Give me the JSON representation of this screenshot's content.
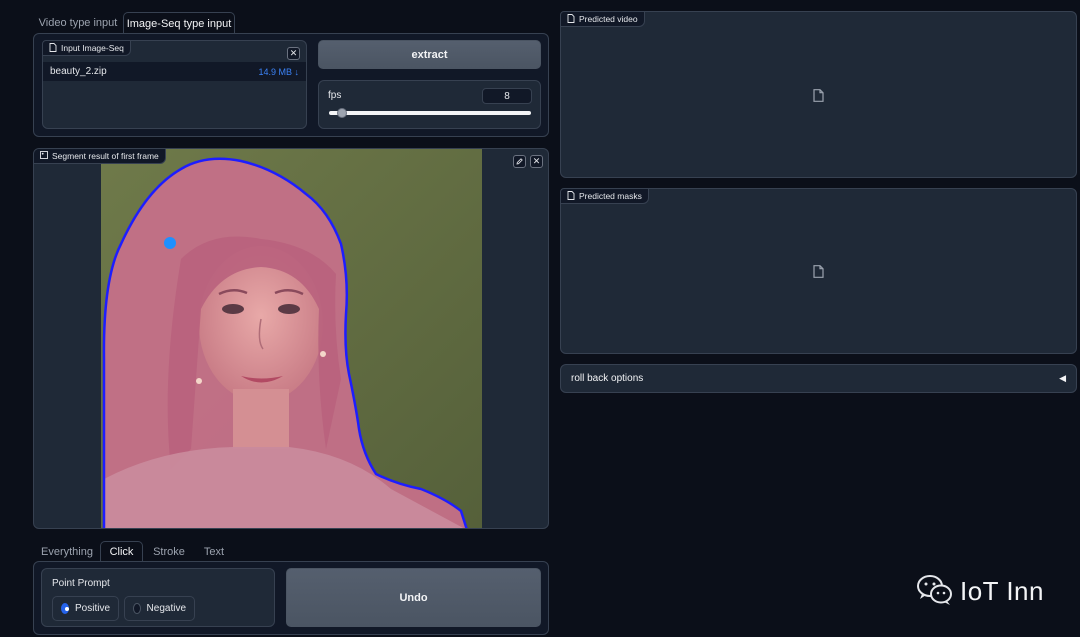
{
  "top_tabs": [
    {
      "label": "Video type input",
      "active": false
    },
    {
      "label": "Image-Seq type input",
      "active": true
    }
  ],
  "input_image_seq": {
    "label": "Input Image-Seq",
    "file_name": "beauty_2.zip",
    "file_size": "14.9 MB ↓"
  },
  "extract_button": "extract",
  "fps": {
    "label": "fps",
    "value": "8",
    "slider_fraction": 0.04
  },
  "segment_result": {
    "label": "Segment result of first frame"
  },
  "predicted_video": {
    "label": "Predicted video"
  },
  "predicted_masks": {
    "label": "Predicted masks"
  },
  "roll_back": {
    "label": "roll back options",
    "arrow": "◀"
  },
  "prompt_tabs": [
    {
      "label": "Everything",
      "active": false
    },
    {
      "label": "Click",
      "active": true
    },
    {
      "label": "Stroke",
      "active": false
    },
    {
      "label": "Text",
      "active": false
    }
  ],
  "point_prompt": {
    "label": "Point Prompt",
    "options": [
      {
        "label": "Positive",
        "selected": true
      },
      {
        "label": "Negative",
        "selected": false
      }
    ]
  },
  "undo_button": "Undo",
  "watermark": "IoT Inn",
  "colors": {
    "background": "#0b0f19",
    "panel": "#1f2937",
    "mask_outline": "#1d1dff",
    "click_point": "#1e90ff",
    "accent": "#2563eb"
  }
}
